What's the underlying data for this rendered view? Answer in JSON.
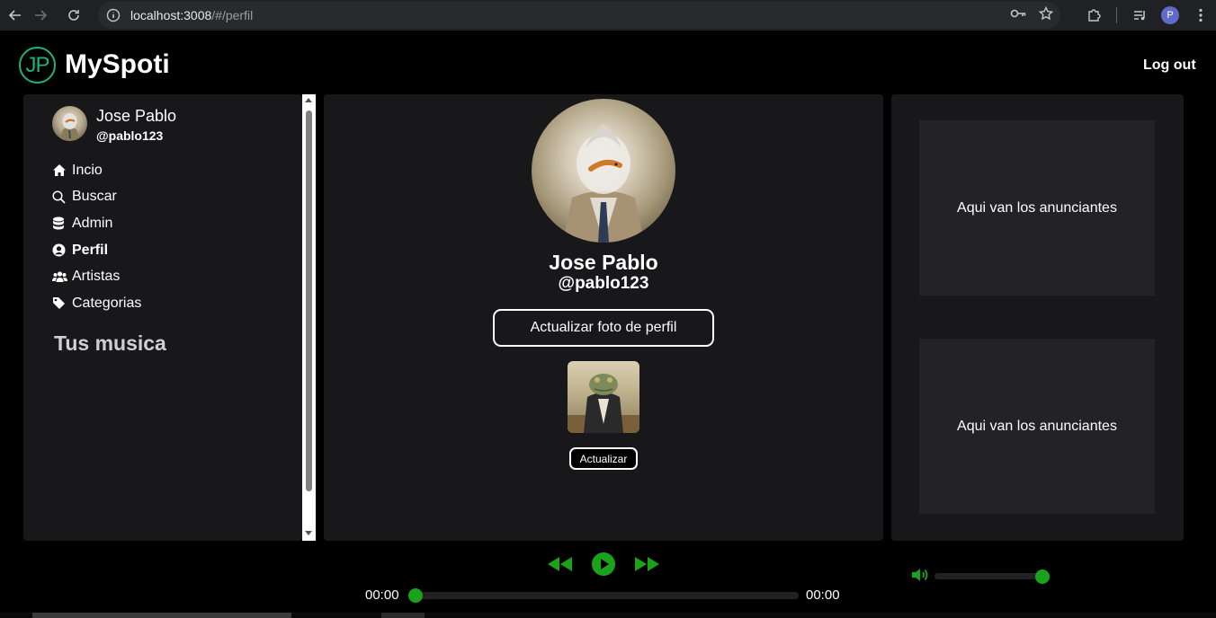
{
  "browser": {
    "url_host": "localhost:3008",
    "url_path": "/#/perfil",
    "profile_initial": "P"
  },
  "header": {
    "logo_text": "JP",
    "brand": "MySpoti",
    "logout_label": "Log out"
  },
  "sidebar": {
    "user_name": "Jose Pablo",
    "user_handle": "@pablo123",
    "items": [
      {
        "label": "Incio",
        "icon": "home-icon",
        "active": false
      },
      {
        "label": "Buscar",
        "icon": "search-icon",
        "active": false
      },
      {
        "label": "Admin",
        "icon": "database-icon",
        "active": false
      },
      {
        "label": "Perfil",
        "icon": "user-circle-icon",
        "active": true
      },
      {
        "label": "Artistas",
        "icon": "users-icon",
        "active": false
      },
      {
        "label": "Categorias",
        "icon": "tag-icon",
        "active": false
      }
    ],
    "section_title": "Tus musica"
  },
  "profile": {
    "name": "Jose Pablo",
    "handle": "@pablo123",
    "update_photo_label": "Actualizar foto de perfil",
    "update_label": "Actualizar"
  },
  "ads": {
    "slot1": "Aqui van los anunciantes",
    "slot2": "Aqui van los anunciantes"
  },
  "player": {
    "current_time": "00:00",
    "total_time": "00:00",
    "progress": 0,
    "volume": 1.0,
    "accent_color": "#1aa31a"
  }
}
